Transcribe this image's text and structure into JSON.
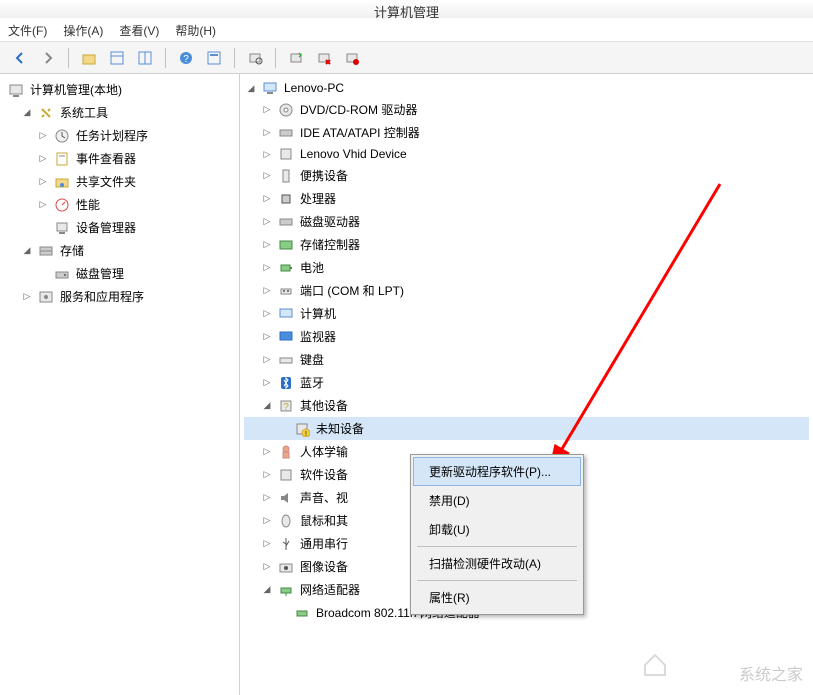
{
  "window": {
    "title": "计算机管理"
  },
  "menu": {
    "file": "文件(F)",
    "action": "操作(A)",
    "view": "查看(V)",
    "help": "帮助(H)"
  },
  "left_tree": {
    "root": "计算机管理(本地)",
    "system_tools": "系统工具",
    "task_scheduler": "任务计划程序",
    "event_viewer": "事件查看器",
    "shared_folders": "共享文件夹",
    "performance": "性能",
    "device_manager": "设备管理器",
    "storage": "存储",
    "disk_management": "磁盘管理",
    "services": "服务和应用程序"
  },
  "right_tree": {
    "root": "Lenovo-PC",
    "dvd": "DVD/CD-ROM 驱动器",
    "ide": "IDE ATA/ATAPI 控制器",
    "lenovo_vhid": "Lenovo Vhid Device",
    "portable": "便携设备",
    "processor": "处理器",
    "disk_drives": "磁盘驱动器",
    "storage_ctrl": "存储控制器",
    "battery": "电池",
    "ports": "端口 (COM 和 LPT)",
    "computer": "计算机",
    "monitor": "监视器",
    "keyboard": "键盘",
    "bluetooth": "蓝牙",
    "other_devices": "其他设备",
    "unknown_device": "未知设备",
    "hid": "人体学输",
    "software": "软件设备",
    "sound": "声音、视",
    "mouse": "鼠标和其",
    "usb": "通用串行",
    "imaging": "图像设备",
    "network": "网络适配器",
    "broadcom": "Broadcom 802.11n 网络适配器"
  },
  "context_menu": {
    "update_driver": "更新驱动程序软件(P)...",
    "disable": "禁用(D)",
    "uninstall": "卸载(U)",
    "scan": "扫描检测硬件改动(A)",
    "properties": "属性(R)"
  },
  "watermark": "系统之家"
}
